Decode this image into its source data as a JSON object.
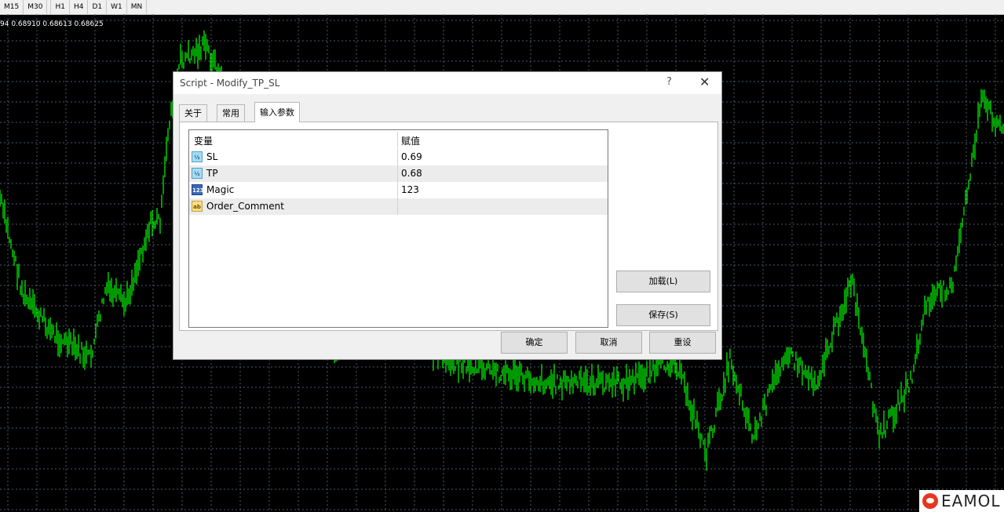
{
  "toolbar": {
    "timeframes": [
      "M15",
      "M30",
      "H1",
      "H4",
      "D1",
      "W1",
      "MN"
    ]
  },
  "chart": {
    "ohlc_readout": "94 0.68910 0.68613 0.68625",
    "candle_color": "#00ff00",
    "grid_color": "#4a5a6a",
    "background": "#000000"
  },
  "dialog": {
    "title": "Script - Modify_TP_SL",
    "help_glyph": "?",
    "close_glyph": "✕",
    "tabs": [
      {
        "label": "关于",
        "active": false
      },
      {
        "label": "常用",
        "active": false
      },
      {
        "label": "输入参数",
        "active": true
      }
    ],
    "grid": {
      "headers": {
        "variable": "变量",
        "value": "赋值"
      },
      "rows": [
        {
          "name": "SL",
          "value": "0.69",
          "icon": "double-type-icon",
          "icon_text": "½"
        },
        {
          "name": "TP",
          "value": "0.68",
          "icon": "double-type-icon",
          "icon_text": "½"
        },
        {
          "name": "Magic",
          "value": "123",
          "icon": "integer-type-icon",
          "icon_text": "123"
        },
        {
          "name": "Order_Comment",
          "value": "",
          "icon": "string-type-icon",
          "icon_text": "ab"
        }
      ]
    },
    "buttons": {
      "load": "加载(L)",
      "save": "保存(S)",
      "ok": "确定",
      "cancel": "取消",
      "reset": "重设"
    }
  },
  "watermark": {
    "text": "EAMOL",
    "logo": "eamol-logo-icon"
  }
}
